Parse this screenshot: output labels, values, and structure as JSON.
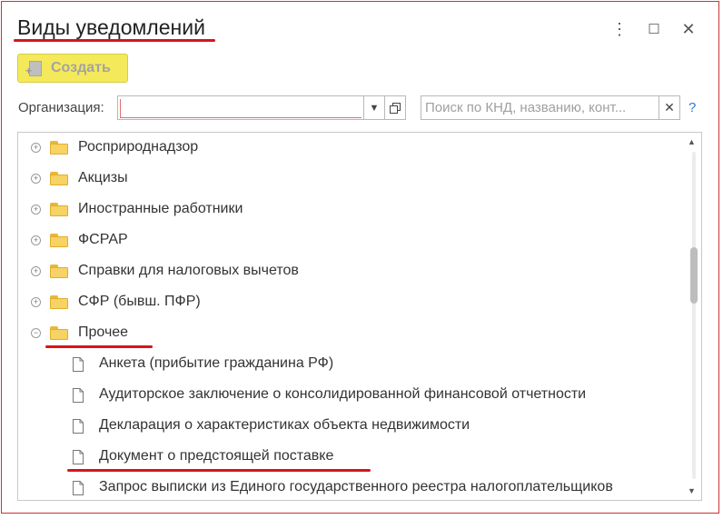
{
  "window": {
    "title": "Виды уведомлений",
    "controls": {
      "more": "⋮",
      "maximize": "☐",
      "close": "✕"
    }
  },
  "toolbar": {
    "create_label": "Создать"
  },
  "filter": {
    "org_label": "Организация:",
    "org_value": "",
    "search_placeholder": "Поиск по КНД, названию, конт...",
    "clear": "✕",
    "help": "?"
  },
  "tree": {
    "folders": [
      {
        "label": "Росприроднадзор",
        "expanded": false
      },
      {
        "label": "Акцизы",
        "expanded": false
      },
      {
        "label": "Иностранные работники",
        "expanded": false
      },
      {
        "label": "ФСРАР",
        "expanded": false
      },
      {
        "label": "Справки для налоговых вычетов",
        "expanded": false
      },
      {
        "label": "СФР (бывш. ПФР)",
        "expanded": false
      },
      {
        "label": "Прочее",
        "expanded": true
      }
    ],
    "documents": [
      {
        "label": "Анкета (прибытие гражданина РФ)"
      },
      {
        "label": "Аудиторское заключение о консолидированной финансовой отчетности"
      },
      {
        "label": "Декларация о характеристиках объекта недвижимости"
      },
      {
        "label": "Документ о предстоящей поставке"
      },
      {
        "label": "Запрос выписки из Единого государственного реестра налогоплательщиков"
      }
    ],
    "expander_collapsed": "+",
    "expander_expanded": "−"
  },
  "colors": {
    "accent_red": "#d8141b",
    "create_btn": "#f4e95a",
    "help_blue": "#2d7ad3"
  }
}
